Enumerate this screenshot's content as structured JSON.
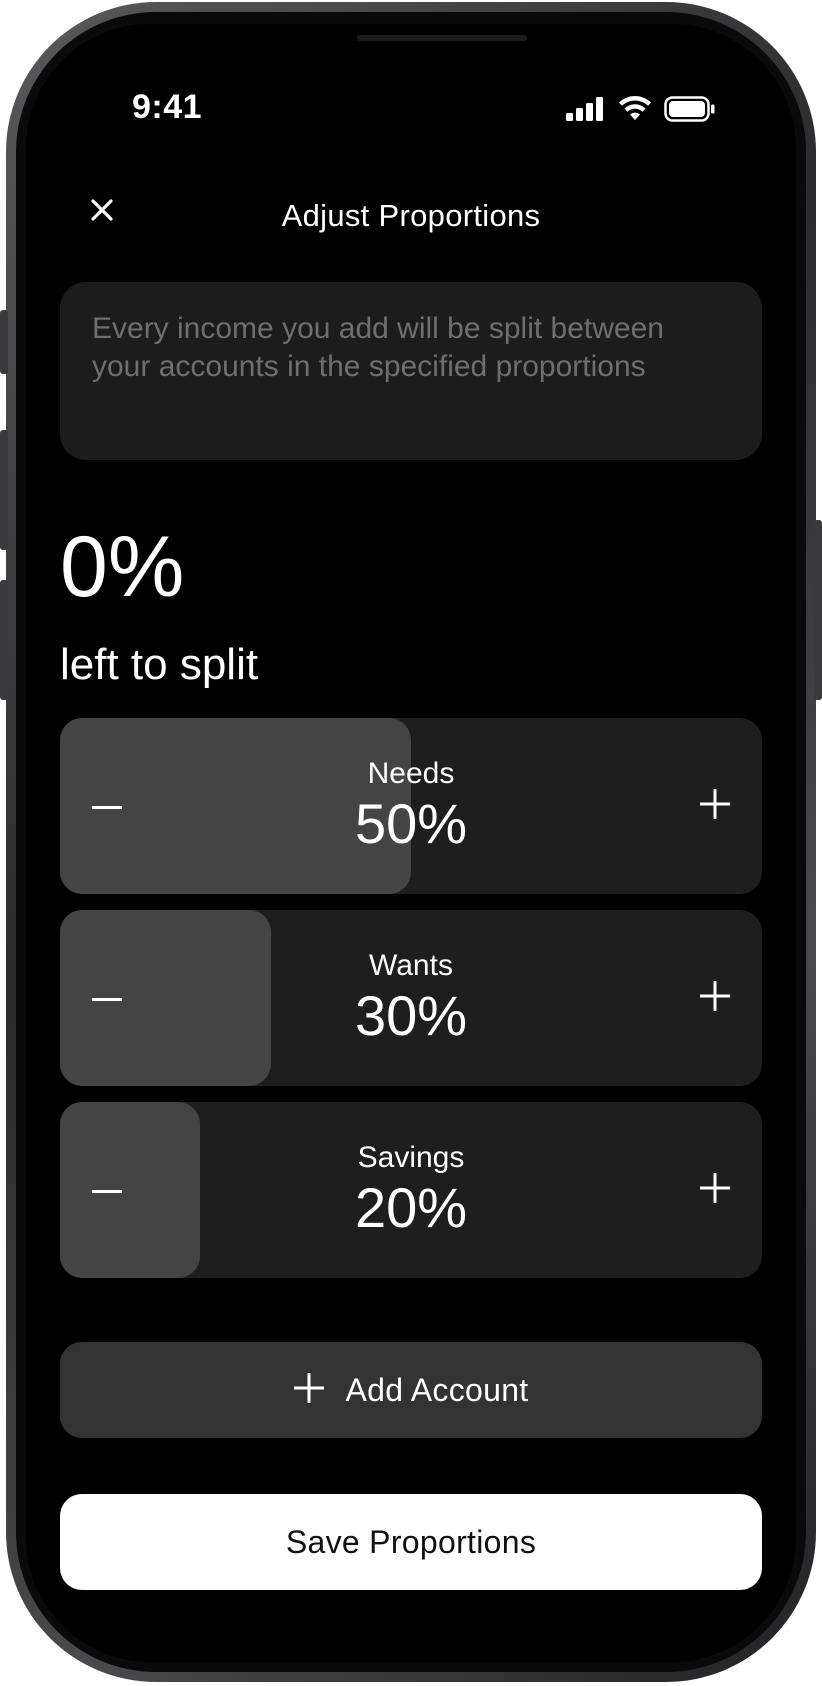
{
  "status_bar": {
    "time": "9:41",
    "icons": [
      "cellular-signal-icon",
      "wifi-icon",
      "battery-icon"
    ]
  },
  "header": {
    "title": "Adjust Proportions",
    "close_icon": "close-icon"
  },
  "info": {
    "text": "Every income you add will be split between your accounts in the specified proportions"
  },
  "summary": {
    "remaining_percent": "0%",
    "remaining_label": "left to split"
  },
  "accounts": [
    {
      "name": "Needs",
      "value": "50%",
      "fraction": 0.5
    },
    {
      "name": "Wants",
      "value": "30%",
      "fraction": 0.3
    },
    {
      "name": "Savings",
      "value": "20%",
      "fraction": 0.2
    }
  ],
  "add_account": {
    "label": "Add Account",
    "icon": "plus-icon"
  },
  "save": {
    "label": "Save Proportions"
  },
  "colors": {
    "background": "#000000",
    "card": "#1e1e1e",
    "fill": "#444444",
    "info_text": "#6f6f6f",
    "add_button": "#333333",
    "save_button": "#ffffff"
  }
}
